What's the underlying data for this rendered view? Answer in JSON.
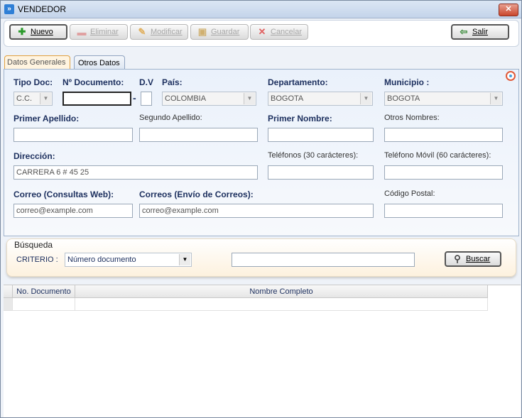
{
  "window": {
    "title": "VENDEDOR",
    "close_glyph": "✕"
  },
  "toolbar": {
    "nuevo": "Nuevo",
    "eliminar": "Eliminar",
    "modificar": "Modificar",
    "guardar": "Guardar",
    "cancelar": "Cancelar",
    "salir": "Salir"
  },
  "tabs": [
    "Datos Generales",
    "Otros Datos"
  ],
  "form": {
    "tipo_doc_label": "Tipo Doc:",
    "tipo_doc_value": "C.C.",
    "documento_label": "Nº Documento:",
    "documento_value": "",
    "dv_label": "D.V",
    "dv_separator": "-",
    "pais_label": "País:",
    "pais_value": "COLOMBIA",
    "departamento_label": "Departamento:",
    "departamento_value": "BOGOTA",
    "municipio_label": "Municipio :",
    "municipio_value": "BOGOTA",
    "primer_apellido_label": "Primer Apellido:",
    "segundo_apellido_label": "Segundo Apellido:",
    "primer_nombre_label": "Primer Nombre:",
    "otros_nombres_label": "Otros Nombres:",
    "direccion_label": "Dirección:",
    "direccion_value": "CARRERA 6 # 45 25",
    "telefonos_label": "Teléfonos (30 carácteres):",
    "telefono_movil_label": "Teléfono Móvil (60 carácteres):",
    "correo_web_label": "Correo (Consultas Web):",
    "correo_web_value": "correo@example.com",
    "correo_envio_label": "Correos (Envío de Correos):",
    "correo_envio_value": "correo@example.com",
    "codigo_postal_label": "Código Postal:"
  },
  "search": {
    "title": "Búsqueda",
    "criterio_label": "CRITERIO :",
    "criterio_value": "Número documento",
    "query": "",
    "button": "Buscar"
  },
  "grid": {
    "columns": [
      "No. Documento",
      "Nombre Completo"
    ],
    "rows": []
  },
  "colors": {
    "label_blue": "#1c2f5e",
    "selected_tab": "#fff4e0",
    "close_red": "#c9462c"
  }
}
